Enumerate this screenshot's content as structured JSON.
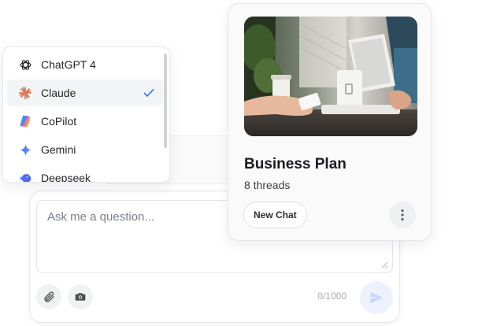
{
  "model_menu": {
    "items": [
      {
        "label": "ChatGPT 4",
        "icon": "openai-icon",
        "selected": false
      },
      {
        "label": "Claude",
        "icon": "claude-icon",
        "selected": true
      },
      {
        "label": "CoPilot",
        "icon": "copilot-icon",
        "selected": false
      },
      {
        "label": "Gemini",
        "icon": "gemini-icon",
        "selected": false
      },
      {
        "label": "Deepseek",
        "icon": "deepseek-icon",
        "selected": false
      }
    ],
    "check_color": "#3b6ee8"
  },
  "composer": {
    "placeholder": "Ask me a question...",
    "char_count": "0/1000",
    "send_color": "#c9d3fb"
  },
  "card": {
    "title": "Business Plan",
    "subtitle": "8 threads",
    "new_chat_label": "New Chat"
  },
  "colors": {
    "claude": "#d97757",
    "gemini": "#4f86f7",
    "deepseek": "#4d6bfe"
  }
}
